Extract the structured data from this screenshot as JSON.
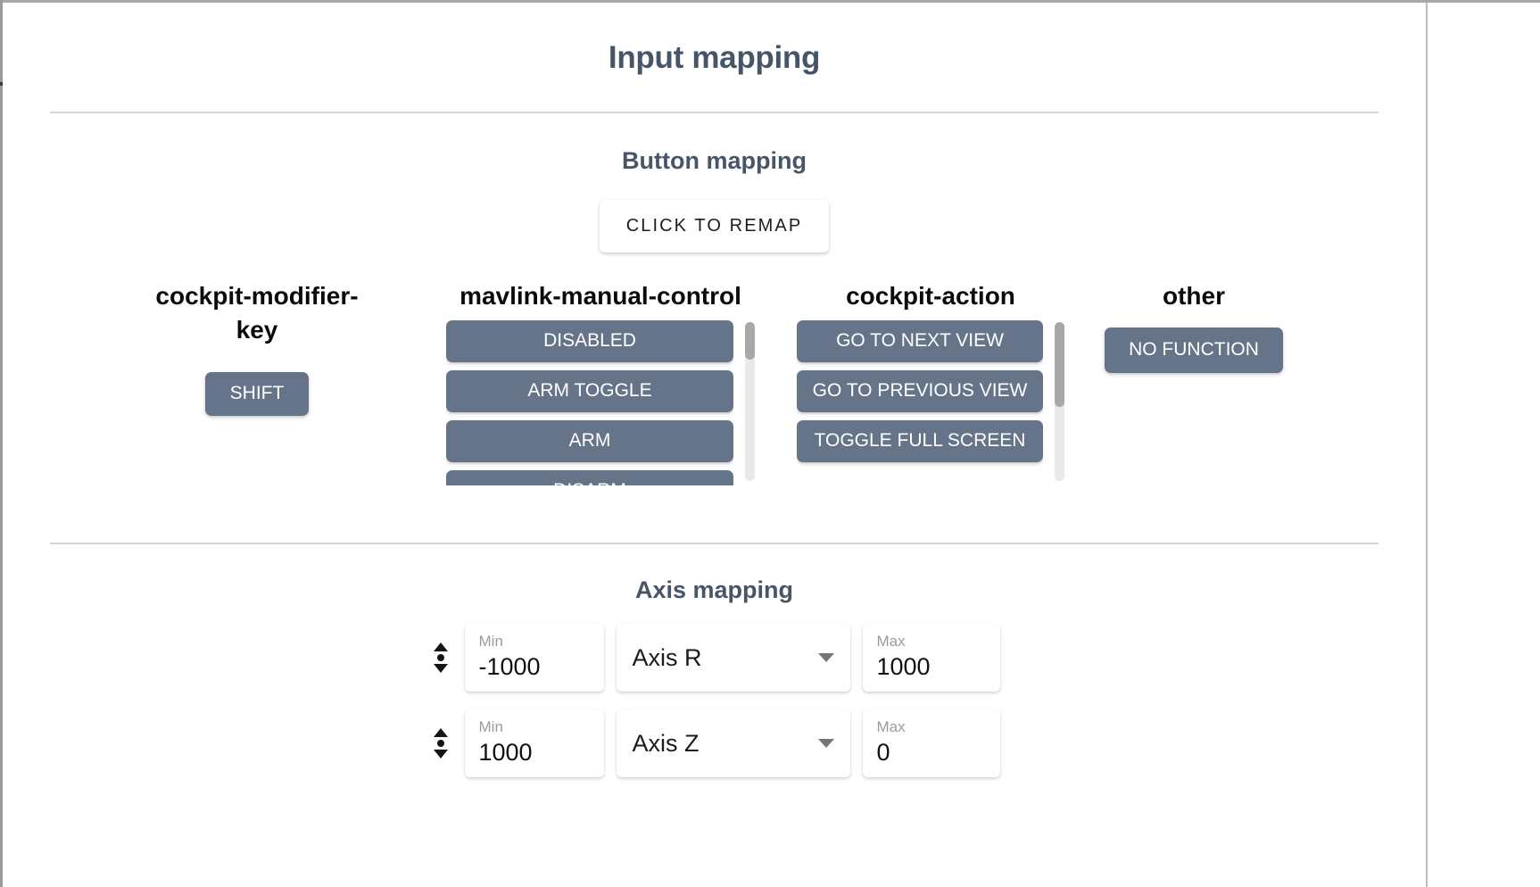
{
  "dialog": {
    "title": "Input mapping"
  },
  "button_mapping": {
    "section_title": "Button mapping",
    "remap_label": "CLICK TO REMAP",
    "columns": [
      {
        "header": "cockpit-modifier-key",
        "items": [
          "SHIFT"
        ]
      },
      {
        "header": "mavlink-manual-control",
        "items": [
          "DISABLED",
          "ARM TOGGLE",
          "ARM",
          "DISARM"
        ]
      },
      {
        "header": "cockpit-action",
        "items": [
          "GO TO NEXT VIEW",
          "GO TO PREVIOUS VIEW",
          "TOGGLE FULL SCREEN"
        ]
      },
      {
        "header": "other",
        "items": [
          "NO FUNCTION"
        ]
      }
    ]
  },
  "axis_mapping": {
    "section_title": "Axis mapping",
    "min_label": "Min",
    "max_label": "Max",
    "rows": [
      {
        "min": "-1000",
        "axis": "Axis R",
        "max": "1000"
      },
      {
        "min": "1000",
        "axis": "Axis Z",
        "max": "0"
      }
    ]
  },
  "colors": {
    "heading": "#475569",
    "chip": "#667489",
    "divider": "#d4d6da",
    "scrollbar_thumb": "#a8a8a8"
  }
}
